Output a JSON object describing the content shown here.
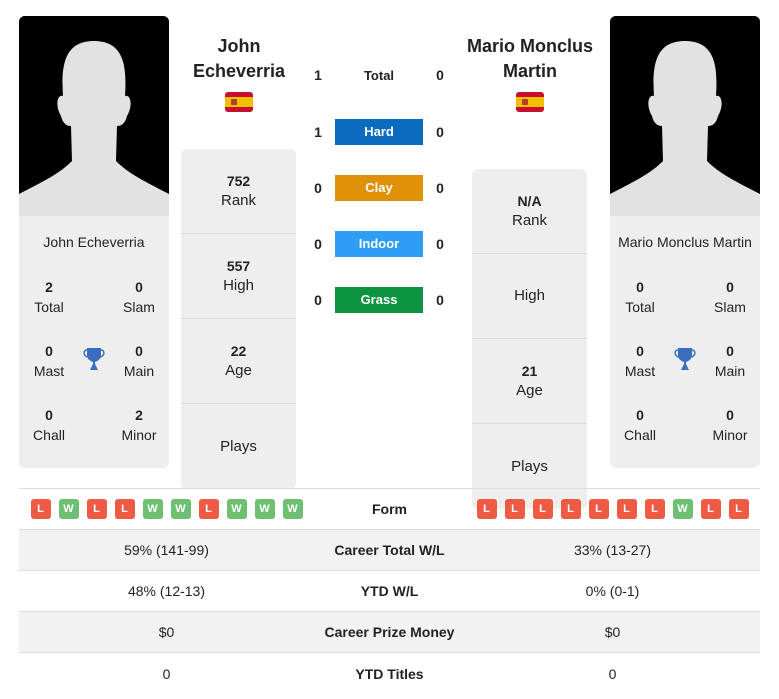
{
  "player1": {
    "name": "John Echeverria",
    "name_line1": "John",
    "name_line2": "Echeverria",
    "flag": "spain-flag",
    "rank": "752",
    "rank_label": "Rank",
    "high": "557",
    "high_label": "High",
    "age": "22",
    "age_label": "Age",
    "plays": "",
    "plays_label": "Plays",
    "titles": {
      "total": "2",
      "total_label": "Total",
      "slam": "0",
      "slam_label": "Slam",
      "mast": "0",
      "mast_label": "Mast",
      "main": "0",
      "main_label": "Main",
      "chall": "0",
      "chall_label": "Chall",
      "minor": "2",
      "minor_label": "Minor"
    },
    "form": [
      "L",
      "W",
      "L",
      "L",
      "W",
      "W",
      "L",
      "W",
      "W",
      "W"
    ]
  },
  "player2": {
    "name": "Mario Monclus Martin",
    "name_line1": "Mario Monclus",
    "name_line2": "Martin",
    "flag": "spain-flag",
    "rank": "N/A",
    "rank_label": "Rank",
    "high": "",
    "high_label": "High",
    "age": "21",
    "age_label": "Age",
    "plays": "",
    "plays_label": "Plays",
    "titles": {
      "total": "0",
      "total_label": "Total",
      "slam": "0",
      "slam_label": "Slam",
      "mast": "0",
      "mast_label": "Mast",
      "main": "0",
      "main_label": "Main",
      "chall": "0",
      "chall_label": "Chall",
      "minor": "0",
      "minor_label": "Minor"
    },
    "form": [
      "L",
      "L",
      "L",
      "L",
      "L",
      "L",
      "L",
      "W",
      "L",
      "L"
    ]
  },
  "h2h": [
    {
      "label": "Total",
      "p1": "1",
      "p2": "0",
      "color": null
    },
    {
      "label": "Hard",
      "p1": "1",
      "p2": "0",
      "color": "#0a6bbf"
    },
    {
      "label": "Clay",
      "p1": "0",
      "p2": "0",
      "color": "#df9208"
    },
    {
      "label": "Indoor",
      "p1": "0",
      "p2": "0",
      "color": "#2e9ef5"
    },
    {
      "label": "Grass",
      "p1": "0",
      "p2": "0",
      "color": "#0d9440"
    }
  ],
  "comparison": [
    {
      "label": "Form",
      "p1": "",
      "p2": ""
    },
    {
      "label": "Career Total W/L",
      "p1": "59% (141-99)",
      "p2": "33% (13-27)"
    },
    {
      "label": "YTD W/L",
      "p1": "48% (12-13)",
      "p2": "0% (0-1)"
    },
    {
      "label": "Career Prize Money",
      "p1": "$0",
      "p2": "$0"
    },
    {
      "label": "YTD Titles",
      "p1": "0",
      "p2": "0"
    }
  ],
  "colors": {
    "win": "#6fbf73",
    "loss": "#ee5b45",
    "trophy": "#3a6fbf"
  }
}
